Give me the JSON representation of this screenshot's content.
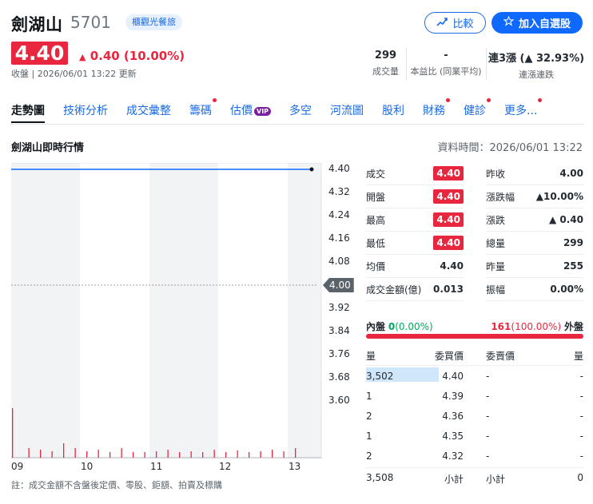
{
  "header": {
    "name": "劍湖山",
    "code": "5701",
    "tag": "櫃觀光餐旅",
    "compare_label": "比較",
    "add_label": "加入自選股",
    "price": "4.40",
    "change": "0.40 (10.00%)",
    "close_info": "收盤 | 2026/06/01 13:22 更新"
  },
  "stats_top": {
    "volume_value": "299",
    "volume_label": "成交量",
    "pe_value": "-",
    "pe_label": "本益比 (同業平均)",
    "streak_value": "連3漲 (▲ 32.93%)",
    "streak_label": "連漲連跌"
  },
  "tabs": [
    {
      "label": "走勢圖"
    },
    {
      "label": "技術分析"
    },
    {
      "label": "成交彙整"
    },
    {
      "label": "籌碼"
    },
    {
      "label": "估價"
    },
    {
      "label": "多空"
    },
    {
      "label": "河流圖"
    },
    {
      "label": "股利"
    },
    {
      "label": "財務"
    },
    {
      "label": "健診"
    },
    {
      "label": "更多..."
    }
  ],
  "vip_label": "VIP",
  "section": {
    "title": "劍湖山即時行情",
    "data_time": "資料時間：2026/06/01 13:22"
  },
  "chart_data": {
    "type": "line",
    "x_ticks": [
      "09",
      "10",
      "11",
      "12",
      "13"
    ],
    "y_ticks": [
      "4.40",
      "4.32",
      "4.24",
      "4.16",
      "4.08",
      "4.00",
      "3.92",
      "3.84",
      "3.76",
      "3.68",
      "3.60"
    ],
    "ylim": [
      3.6,
      4.4
    ],
    "reference_price": "4.00",
    "series": [
      {
        "x": [
          "09:00",
          "13:22"
        ],
        "values": [
          4.4,
          4.4
        ]
      }
    ],
    "volume_bars": [
      0.62,
      0.12,
      0.1,
      0.08,
      0.18,
      0.12,
      0.08,
      0.1,
      0.07,
      0.12,
      0.07,
      0.07,
      0.08,
      0.1,
      0.07,
      0.08,
      0.07,
      0.1,
      0.07,
      0.09,
      0.07,
      0.08,
      0.1,
      0.08,
      0.12
    ]
  },
  "quote_left": [
    {
      "label": "成交",
      "value": "4.40",
      "pill": true
    },
    {
      "label": "開盤",
      "value": "4.40",
      "pill": true
    },
    {
      "label": "最高",
      "value": "4.40",
      "pill": true
    },
    {
      "label": "最低",
      "value": "4.40",
      "pill": true
    },
    {
      "label": "均價",
      "value": "4.40",
      "pill": false
    },
    {
      "label": "成交金額(億)",
      "value": "0.013",
      "pill": false
    }
  ],
  "quote_right": [
    {
      "label": "昨收",
      "value": "4.00",
      "red": false
    },
    {
      "label": "漲跌幅",
      "value": "▲10.00%",
      "red": true
    },
    {
      "label": "漲跌",
      "value": "▲ 0.40",
      "red": true
    },
    {
      "label": "總量",
      "value": "299",
      "red": false
    },
    {
      "label": "昨量",
      "value": "255",
      "red": false
    },
    {
      "label": "振幅",
      "value": "0.00%",
      "red": false
    }
  ],
  "ratio": {
    "inner_label": "內盤",
    "inner_value": "0",
    "inner_pct": "(0.00%)",
    "outer_value": "161",
    "outer_pct": "(100.00%)",
    "outer_label": "外盤"
  },
  "orderbook": {
    "headers": {
      "qty": "量",
      "bid": "委買價",
      "ask": "委賣價",
      "qty2": "量"
    },
    "rows": [
      {
        "bid_qty": "3,502",
        "bid": "4.40",
        "ask": "-",
        "ask_qty": "-",
        "bar": 0.65
      },
      {
        "bid_qty": "1",
        "bid": "4.39",
        "ask": "-",
        "ask_qty": "-",
        "bar": 0
      },
      {
        "bid_qty": "2",
        "bid": "4.36",
        "ask": "-",
        "ask_qty": "-",
        "bar": 0
      },
      {
        "bid_qty": "1",
        "bid": "4.35",
        "ask": "-",
        "ask_qty": "-",
        "bar": 0
      },
      {
        "bid_qty": "2",
        "bid": "4.32",
        "ask": "-",
        "ask_qty": "-",
        "bar": 0
      }
    ],
    "bid_total": "3,508",
    "subtotal_label": "小計",
    "ask_total": "0"
  },
  "note": "註：成交金額不含盤後定價、零股、鉅額、拍賣及標購",
  "colors": {
    "up": "#e8273f",
    "down": "#00ab5e",
    "accent": "#196ae5"
  }
}
